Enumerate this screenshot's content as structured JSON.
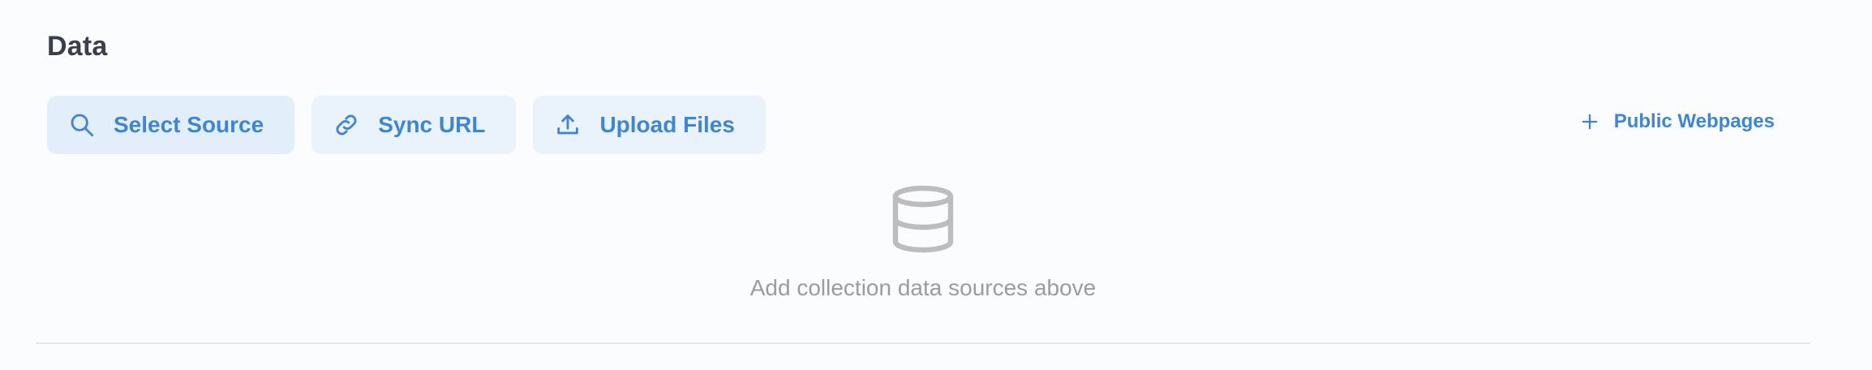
{
  "section": {
    "title": "Data"
  },
  "toolbar": {
    "buttons": [
      {
        "label": "Select Source",
        "icon": "search-icon"
      },
      {
        "label": "Sync URL",
        "icon": "link-icon"
      },
      {
        "label": "Upload Files",
        "icon": "upload-icon"
      }
    ],
    "public_link": {
      "label": "Public Webpages",
      "icon": "plus-icon"
    }
  },
  "empty_state": {
    "icon": "database-icon",
    "message": "Add collection data sources above"
  },
  "colors": {
    "accent": "#3f85d4",
    "selected_bg": "#e2effb",
    "button_bg": "#eaf3fc",
    "muted_text": "#9a9ca2",
    "title_text": "#3a3f4b"
  }
}
